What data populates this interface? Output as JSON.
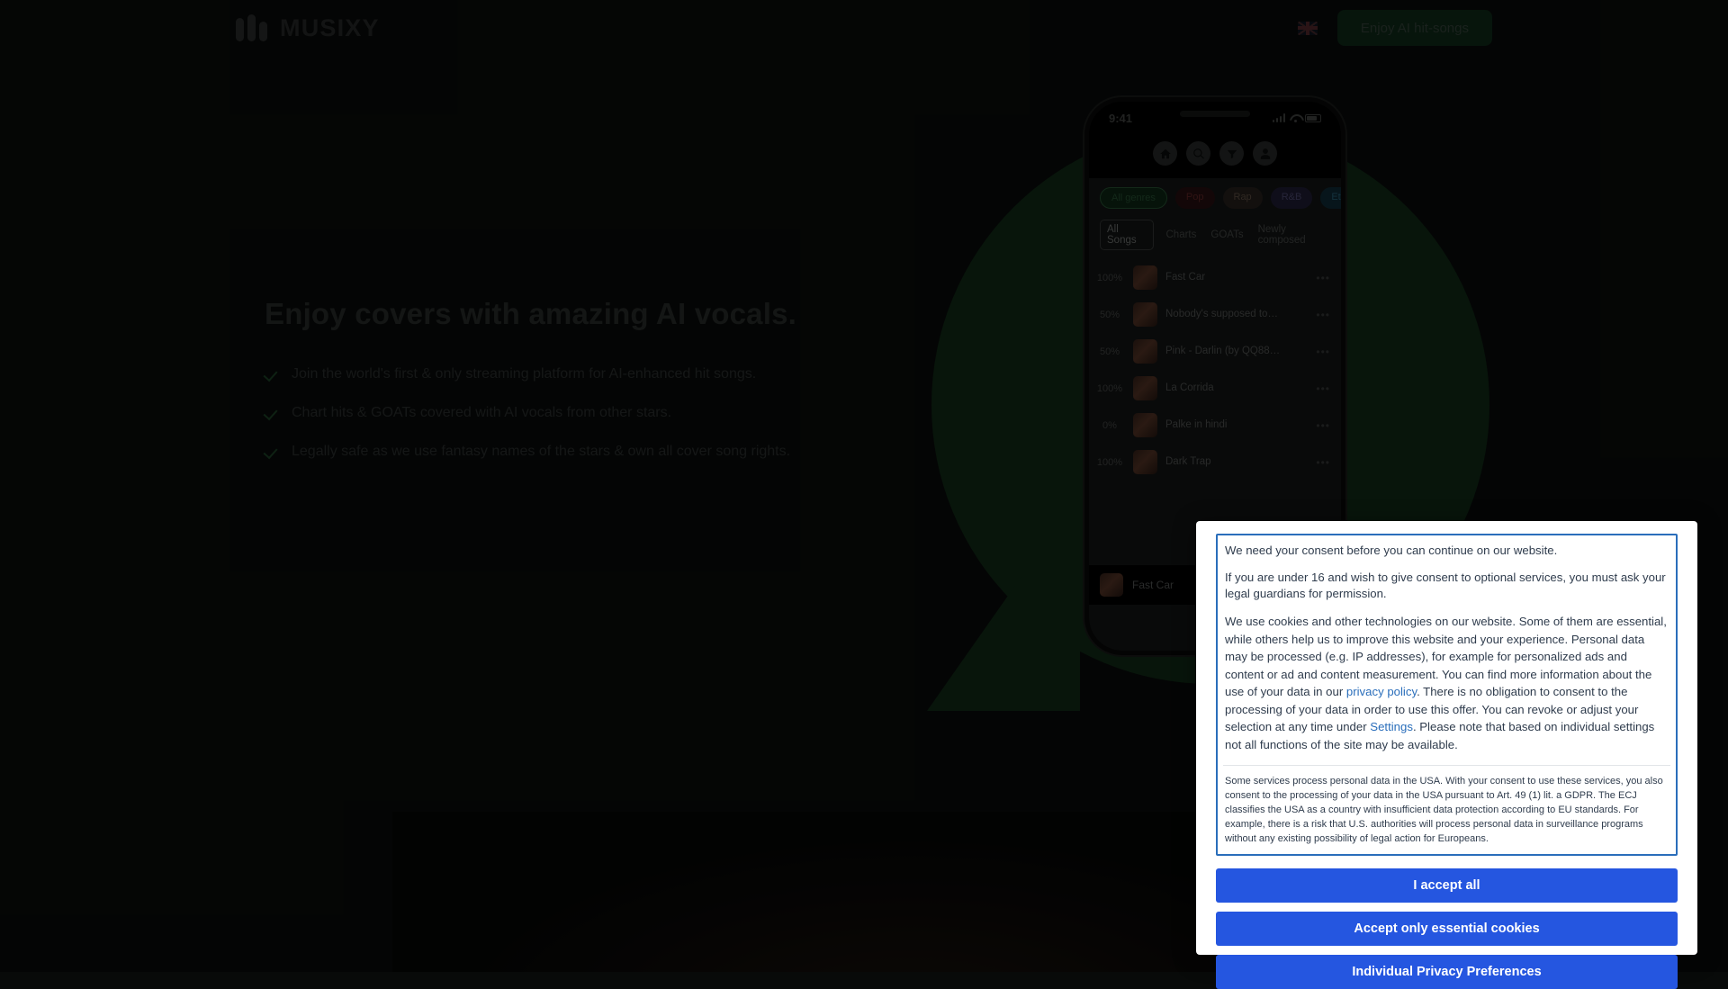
{
  "header": {
    "brand_name": "MUSIXY",
    "brand_mark_icon": "three-bars-logo-icon",
    "language_flag_icon": "uk-flag-icon",
    "cta_label": "Enjoy AI hit-songs"
  },
  "hero": {
    "title": "Enjoy covers with amazing AI vocals.",
    "bullets": [
      "Join the world's first & only streaming platform for AI-enhanced hit songs.",
      "Chart hits & GOATs covered with AI vocals from other stars.",
      "Legally safe as we use fantasy names of the stars & own all cover song rights."
    ],
    "check_icon": "check-icon"
  },
  "phone": {
    "status": {
      "time": "9:41",
      "signal_icon": "signal-bars-icon",
      "wifi_icon": "wifi-icon",
      "battery_icon": "battery-icon"
    },
    "nav_icons": [
      "home-icon",
      "search-icon",
      "filter-icon",
      "profile-icon"
    ],
    "genres": [
      {
        "label": "All genres",
        "style": "g-all"
      },
      {
        "label": "Pop",
        "style": "g-pop"
      },
      {
        "label": "Rap",
        "style": "g-rap"
      },
      {
        "label": "R&B",
        "style": "g-rnb"
      },
      {
        "label": "Etno",
        "style": "g-etno"
      }
    ],
    "tabs": [
      {
        "label": "All Songs",
        "active": true
      },
      {
        "label": "Charts",
        "active": false
      },
      {
        "label": "GOATs",
        "active": false
      },
      {
        "label": "Newly composed",
        "active": false
      }
    ],
    "songs": [
      {
        "percent": "100%",
        "title": "Fast Car",
        "subtitle": ""
      },
      {
        "percent": "50%",
        "title": "Nobody's supposed to…",
        "subtitle": ""
      },
      {
        "percent": "50%",
        "title": "Pink - Darlin (by QQ88…",
        "subtitle": ""
      },
      {
        "percent": "100%",
        "title": "La Corrida",
        "subtitle": ""
      },
      {
        "percent": "0%",
        "title": "Palke in hindi",
        "subtitle": ""
      },
      {
        "percent": "100%",
        "title": "Dark Trap",
        "subtitle": ""
      }
    ],
    "now_playing": {
      "title": "Fast Car"
    },
    "more_icon": "more-dots-icon"
  },
  "cookie_dialog": {
    "lead": "We need your consent before you can continue on our website.",
    "paragraph_minor": "If you are under 16 and wish to give consent to optional services, you must ask your legal guardians for permission.",
    "paragraph_main_1": "We use cookies and other technologies on our website. Some of them are essential, while others help us to improve this website and your experience. Personal data may be processed (e.g. IP addresses), for example for personalized ads and content or ad and content measurement. You can find more information about the use of your data in our ",
    "privacy_policy_link": "privacy policy",
    "paragraph_main_2": ". There is no obligation to consent to the processing of your data in order to use this offer. You can revoke or adjust your selection at any time under ",
    "settings_link": "Settings",
    "paragraph_main_3": ". Please note that based on individual settings not all functions of the site may be available.",
    "usa_notice": "Some services process personal data in the USA. With your consent to use these services, you also consent to the processing of your data in the USA pursuant to Art. 49 (1) lit. a GDPR. The ECJ classifies the USA as a country with insufficient data protection according to EU standards. For example, there is a risk that U.S. authorities will process personal data in surveillance programs without any existing possibility of legal action for Europeans.",
    "buttons": [
      {
        "label": "I accept all",
        "name": "accept-all-button"
      },
      {
        "label": "Accept only essential cookies",
        "name": "accept-essential-button"
      },
      {
        "label": "Individual Privacy Preferences",
        "name": "individual-preferences-button"
      }
    ]
  },
  "colors": {
    "accent_green": "#12301a",
    "button_blue": "#2556e0",
    "link_blue": "#2a6ebb",
    "page_bg": "#0b0d0c"
  }
}
